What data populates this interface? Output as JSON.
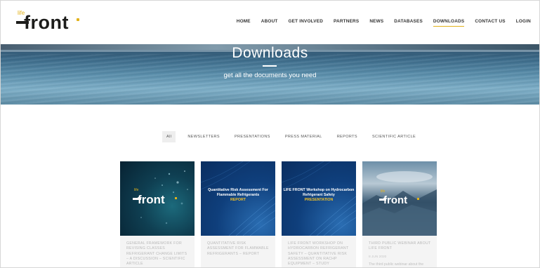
{
  "brand": {
    "life": "life",
    "word": "front"
  },
  "nav": [
    "HOME",
    "ABOUT",
    "GET INVOLVED",
    "PARTNERS",
    "NEWS",
    "DATABASES",
    "DOWNLOADS",
    "CONTACT US",
    "LOGIN"
  ],
  "nav_active": "DOWNLOADS",
  "hero": {
    "title": "Downloads",
    "subtitle": "get all the documents you need"
  },
  "filters": [
    "All",
    "NEWSLETTERS",
    "PRESENTATIONS",
    "PRESS MATERIAL",
    "REPORTS",
    "SCIENTIFIC ARTICLE"
  ],
  "filter_active": "All",
  "cards": [
    {
      "image": "life-front-logo-dark",
      "title": "GENERAL FRAMEWORK FOR REVISING CLASSES REFRIGERANT CHANGE LIMITS – A DISCUSSION – SCIENTIFIC ARTICLE",
      "date": "",
      "desc": ""
    },
    {
      "image": "report-cover",
      "cover_title": "Quantitative Risk Assessment For Flammable Refrigerants",
      "cover_tag": "REPORT",
      "title": "QUANTITATIVE RISK ASSESSMENT FOR FLAMMABLE REFRIGERANTS – REPORT",
      "date": "",
      "desc": ""
    },
    {
      "image": "presentation-cover",
      "cover_title": "LIFE FRONT Workshop on Hydrocarbon Refrigerant Safety",
      "cover_tag": "PRESENTATION",
      "title": "LIFE FRONT WORKSHOP ON HYDROCARBON REFRIGERANT SAFETY – QUANTITATIVE RISK ASSESSMENT ON RACHP EQUIPMENT – STUDY",
      "date": "",
      "desc": ""
    },
    {
      "image": "life-front-logo-sky",
      "title": "THIRD PUBLIC WEBINAR ABOUT LIFE FRONT",
      "date": "8 JUN 2020",
      "desc": "The third public webinar about the"
    }
  ],
  "colors": {
    "accent": "#e2b21a",
    "text": "#1d1d1b",
    "hero_blue": "#3c6b8a"
  }
}
